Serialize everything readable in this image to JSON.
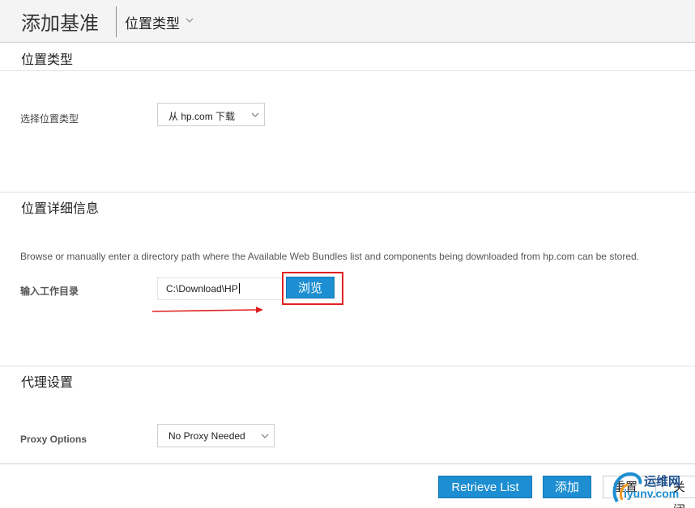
{
  "header": {
    "title": "添加基准",
    "breadcrumb": "位置类型"
  },
  "location_type": {
    "section_title": "位置类型",
    "label": "选择位置类型",
    "selected": "从 hp.com 下载"
  },
  "location_details": {
    "section_title": "位置详细信息",
    "description": "Browse or manually enter a directory path where the Available Web Bundles list and components being downloaded from hp.com can be stored.",
    "label": "输入工作目录",
    "path_value": "C:\\Download\\HP",
    "browse_label": "浏览"
  },
  "proxy": {
    "section_title": "代理设置",
    "label": "Proxy Options",
    "selected": "No Proxy Needed"
  },
  "footer": {
    "retrieve_label": "Retrieve List",
    "add_label": "添加",
    "reset_label": "重置",
    "close_label": "关闭"
  },
  "watermark": {
    "line1": "运维网",
    "line2": "iyunv.com"
  },
  "colors": {
    "accent_blue": "#1d8ed2",
    "annotation_red": "#e02020"
  }
}
